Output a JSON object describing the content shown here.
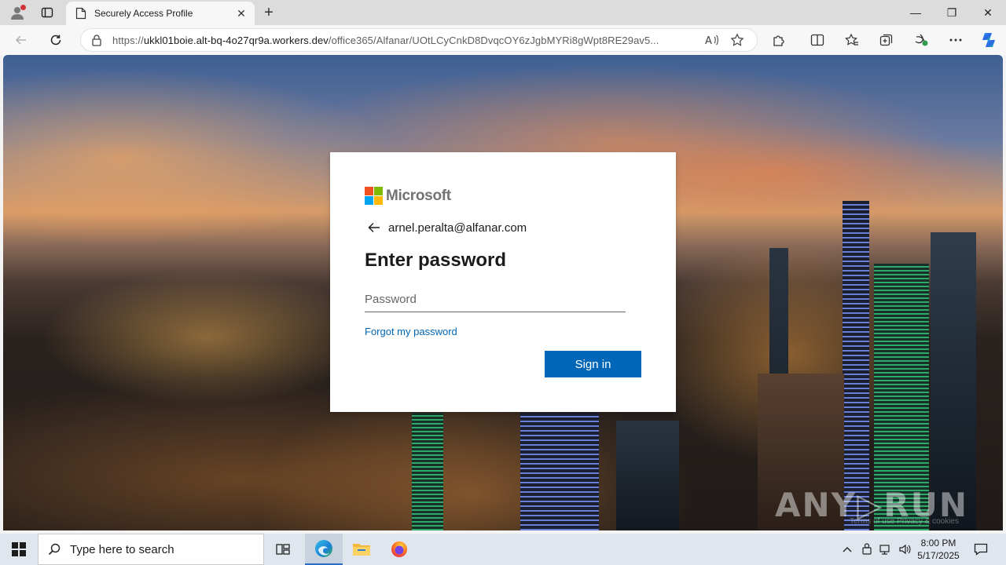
{
  "browser": {
    "tab_title": "Securely Access Profile",
    "tab_close": "✕",
    "new_tab": "+",
    "url_prefix": "https://",
    "url_host": "ukkl01boie.alt-bq-4o27qr9a.workers.dev",
    "url_path": "/office365/Alfanar/UOtLCyCnkD8DvqcOY6zJgbMYRi8gWpt8RE29av5...",
    "window_controls": {
      "minimize": "—",
      "restore": "❐",
      "close": "✕"
    }
  },
  "login": {
    "brand": "Microsoft",
    "email": "arnel.peralta@alfanar.com",
    "heading": "Enter password",
    "password_placeholder": "Password",
    "password_value": "",
    "forgot_link": "Forgot my password",
    "signin_label": "Sign in"
  },
  "watermark": {
    "text": "ANY▷RUN",
    "sub": "Terms of use    Privacy & cookies"
  },
  "taskbar": {
    "search_placeholder": "Type here to search",
    "time": "8:00 PM",
    "date": "5/17/2025"
  },
  "colors": {
    "signin_bg": "#0067b8",
    "link": "#0067b8",
    "ms_red": "#f25022",
    "ms_green": "#7fba00",
    "ms_blue": "#00a4ef",
    "ms_yellow": "#ffb900"
  }
}
